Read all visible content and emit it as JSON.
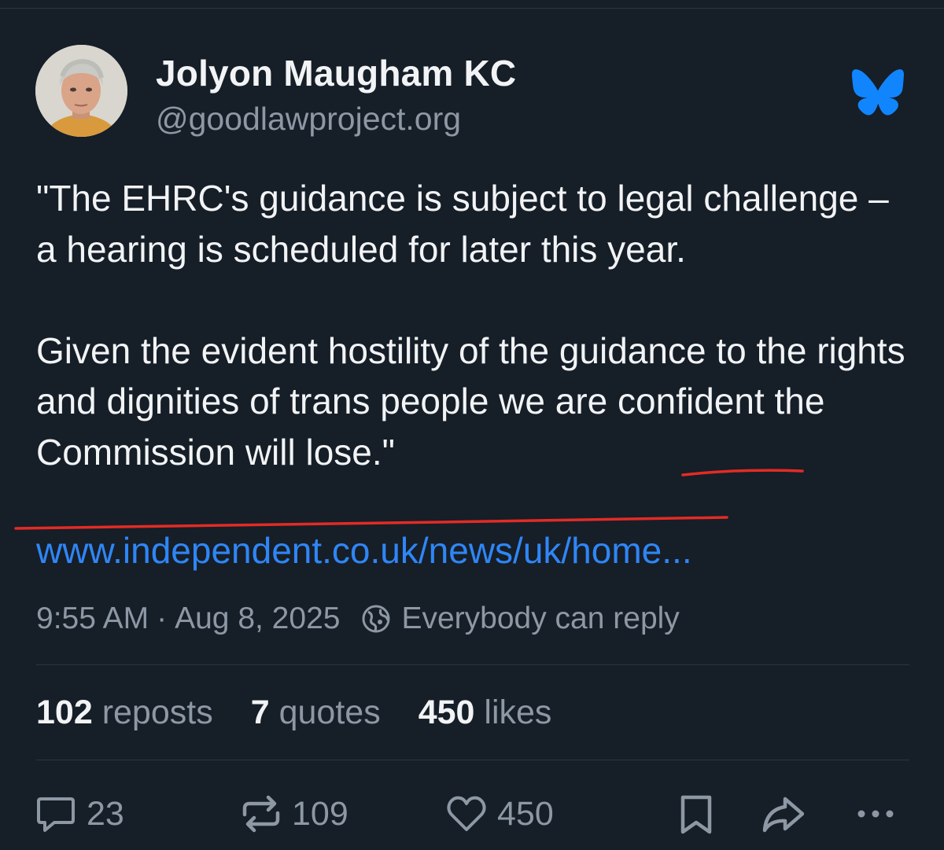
{
  "post": {
    "author": {
      "display_name": "Jolyon Maugham KC",
      "handle": "@goodlawproject.org"
    },
    "body": {
      "paragraph1": "\"The EHRC's guidance is subject to legal challenge – a hearing is scheduled for later this year.",
      "paragraph2": "Given the evident hostility of the guidance to the rights and dignities of trans people we are confident the Commission will lose.\""
    },
    "link": "www.independent.co.uk/news/uk/home...",
    "meta": {
      "time": "9:55 AM",
      "separator": "·",
      "date": "Aug 8, 2025",
      "reply_setting": "Everybody can reply"
    },
    "stats": {
      "reposts": {
        "count": "102",
        "label": "reposts"
      },
      "quotes": {
        "count": "7",
        "label": "quotes"
      },
      "likes": {
        "count": "450",
        "label": "likes"
      }
    },
    "actions": {
      "replies": "23",
      "reposts": "109",
      "likes": "450"
    }
  },
  "icons": {
    "platform_logo": "butterfly-icon",
    "reply": "speech-bubble-icon",
    "repost": "repost-arrows-icon",
    "like": "heart-icon",
    "bookmark": "bookmark-icon",
    "share": "share-arrow-icon",
    "more": "more-dots-icon",
    "reply_setting": "globe-icon"
  },
  "colors": {
    "background": "#161e27",
    "text_primary": "#f1f3f5",
    "text_secondary": "#8d98a5",
    "link": "#2f86f6",
    "brand_blue": "#1185fe",
    "annotation_red": "#e32b25"
  }
}
